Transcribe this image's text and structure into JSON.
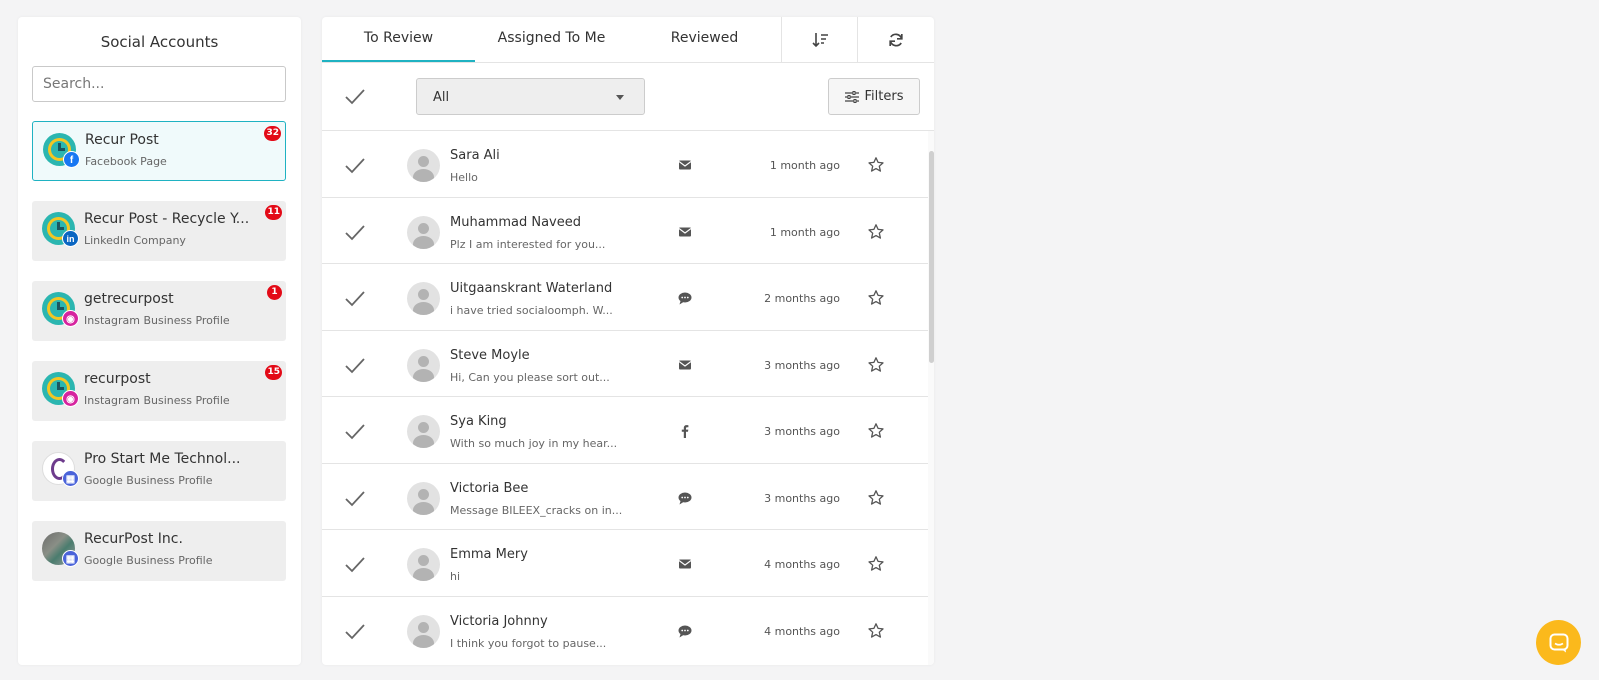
{
  "left_panel": {
    "title": "Social Accounts",
    "search_placeholder": "Search...",
    "accounts": [
      {
        "name": "Recur Post",
        "type": "Facebook Page",
        "count": "32",
        "network": "facebook",
        "active": true
      },
      {
        "name": "Recur Post - Recycle Y...",
        "type": "LinkedIn Company",
        "count": "11",
        "network": "linkedin",
        "active": false
      },
      {
        "name": "getrecurpost",
        "type": "Instagram Business Profile",
        "count": "1",
        "network": "instagram",
        "active": false
      },
      {
        "name": "recurpost",
        "type": "Instagram Business Profile",
        "count": "15",
        "network": "instagram",
        "active": false
      },
      {
        "name": "Pro Start Me Technol...",
        "type": "Google Business Profile",
        "count": "",
        "network": "google-business",
        "active": false
      },
      {
        "name": "RecurPost Inc.",
        "type": "Google Business Profile",
        "count": "",
        "network": "google-business",
        "active": false
      }
    ]
  },
  "tabs": {
    "to_review": "To Review",
    "assigned": "Assigned To Me",
    "reviewed": "Reviewed",
    "sort_icon": "sort-descending-icon",
    "refresh_icon": "refresh-icon"
  },
  "toolbar": {
    "select_value": "All",
    "filters_label": "Filters"
  },
  "messages": [
    {
      "name": "Sara Ali",
      "preview": "Hello",
      "type": "envelope",
      "time": "1 month ago"
    },
    {
      "name": "Muhammad Naveed",
      "preview": "Plz I am interested for you...",
      "type": "envelope",
      "time": "1 month ago"
    },
    {
      "name": "Uitgaanskrant Waterland",
      "preview": "i have tried socialoomph. W...",
      "type": "comment",
      "time": "2 months ago"
    },
    {
      "name": "Steve Moyle",
      "preview": "Hi, Can you please sort out...",
      "type": "envelope",
      "time": "3 months ago"
    },
    {
      "name": "Sya King",
      "preview": "With so much joy in my hear...",
      "type": "facebook",
      "time": "3 months ago"
    },
    {
      "name": "Victoria Bee",
      "preview": "Message BILEEX_cracks on in...",
      "type": "comment",
      "time": "3 months ago"
    },
    {
      "name": "Emma Mery",
      "preview": "hi",
      "type": "envelope",
      "time": "4 months ago"
    },
    {
      "name": "Victoria Johnny",
      "preview": "I think you forgot to pause...",
      "type": "comment",
      "time": "4 months ago"
    }
  ],
  "colors": {
    "accent": "#1fb2c2",
    "badge": "#e30a17",
    "chat": "#fbb91c"
  }
}
